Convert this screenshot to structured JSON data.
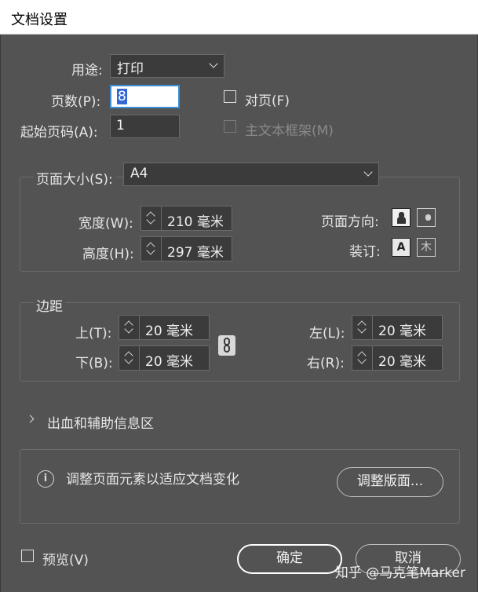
{
  "window": {
    "title": "文档设置"
  },
  "general": {
    "intent_label": "用途:",
    "intent_value": "打印",
    "pages_label": "页数(P):",
    "pages_value": "8",
    "start_page_label": "起始页码(A):",
    "start_page_value": "1",
    "facing_pages_label": "对页(F)",
    "facing_pages_checked": false,
    "primary_text_frame_label": "主文本框架(M)",
    "primary_text_frame_checked": false,
    "primary_text_frame_disabled": true
  },
  "page_size": {
    "label": "页面大小(S):",
    "value": "A4",
    "width_label": "宽度(W):",
    "width_value": "210 毫米",
    "height_label": "高度(H):",
    "height_value": "297 毫米",
    "orientation_label": "页面方向:",
    "orientation_selected": "portrait",
    "binding_label": "装订:",
    "binding_left_glyph": "A",
    "binding_right_glyph": "木",
    "binding_selected": "left-to-right"
  },
  "margins": {
    "legend": "边距",
    "top_label": "上(T):",
    "top_value": "20 毫米",
    "bottom_label": "下(B):",
    "bottom_value": "20 毫米",
    "left_label": "左(L):",
    "left_value": "20 毫米",
    "right_label": "右(R):",
    "right_value": "20 毫米",
    "linked": true
  },
  "bleed": {
    "label": "出血和辅助信息区",
    "expanded": false
  },
  "adjust": {
    "info_glyph": "i",
    "message": "调整页面元素以适应文档变化",
    "button_label": "调整版面..."
  },
  "footer": {
    "preview_label": "预览(V)",
    "preview_checked": false,
    "ok_label": "确定",
    "cancel_label": "取消"
  },
  "watermark": "知乎 @马克笔Marker",
  "colors": {
    "dialog_bg": "#535353",
    "field_bg": "#3b3b3b",
    "focus_ring": "#3b8fd6",
    "selection": "#3367d6",
    "text": "#e6e6e6"
  }
}
